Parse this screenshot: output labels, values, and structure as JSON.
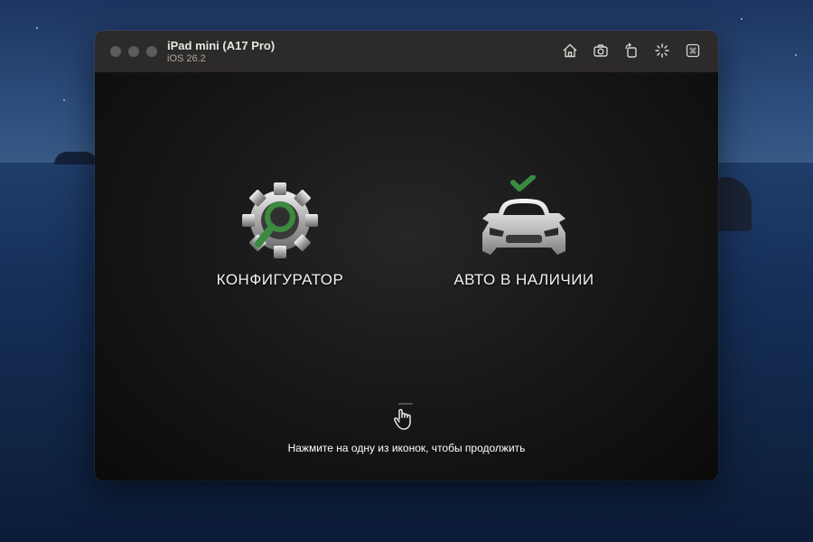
{
  "window": {
    "title": "iPad mini (A17 Pro)",
    "subtitle": "iOS 26.2"
  },
  "toolbar": {
    "icons": [
      "home-icon",
      "screenshot-icon",
      "rotate-icon",
      "shake-icon",
      "command-icon"
    ]
  },
  "app": {
    "tiles": [
      {
        "label": "КОНФИГУРАТОР",
        "icon": "gear-magnifier-icon"
      },
      {
        "label": "АВТО В НАЛИЧИИ",
        "icon": "car-checkmark-icon"
      }
    ],
    "hint": "Нажмите на одну из иконок, чтобы продолжить"
  },
  "colors": {
    "accent_green": "#3b8a3e",
    "titlebar": "#2d2b2a",
    "screen_bg": "#171717"
  }
}
